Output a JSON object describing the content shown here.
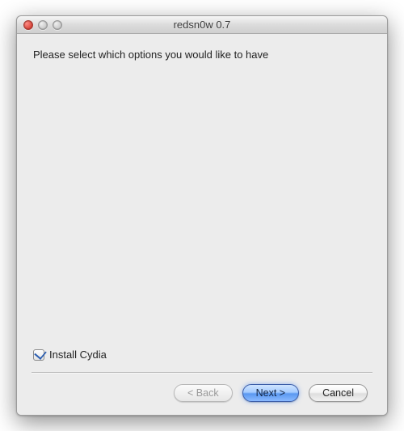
{
  "window": {
    "title": "redsn0w 0.7"
  },
  "content": {
    "instruction": "Please select which options you would like to have"
  },
  "options": {
    "install_cydia": {
      "label": "Install Cydia",
      "checked": true
    }
  },
  "buttons": {
    "back": "< Back",
    "next": "Next >",
    "cancel": "Cancel"
  }
}
